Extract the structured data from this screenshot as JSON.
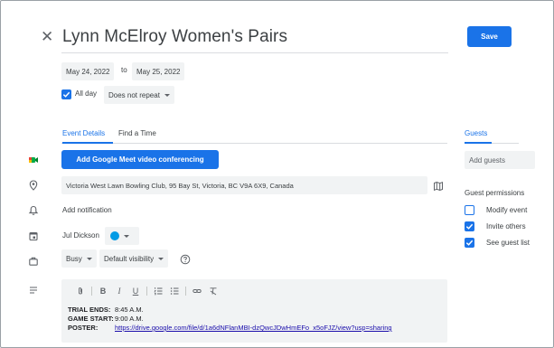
{
  "event": {
    "title": "Lynn McElroy Women's Pairs",
    "save_label": "Save",
    "start_date": "May 24, 2022",
    "to_label": "to",
    "end_date": "May 25, 2022",
    "all_day_label": "All day",
    "all_day_checked": true,
    "repeat_label": "Does not repeat"
  },
  "tabs": [
    {
      "label": "Event Details",
      "active": true
    },
    {
      "label": "Find a Time",
      "active": false
    }
  ],
  "details": {
    "meet_button_label": "Add Google Meet video conferencing",
    "location": "Victoria West Lawn Bowling Club, 95 Bay St, Victoria, BC V9A 6X9, Canada",
    "add_notification_label": "Add notification",
    "calendar_owner": "Jul Dickson",
    "calendar_color": "#039be5",
    "busy_label": "Busy",
    "visibility_label": "Default visibility"
  },
  "toolbar_icons": [
    "attach-icon",
    "bold-icon",
    "italic-icon",
    "underline-icon",
    "numbered-list-icon",
    "bulleted-list-icon",
    "link-icon",
    "clear-format-icon"
  ],
  "description": {
    "lines": [
      {
        "key": "TRIAL ENDS:",
        "value": "8:45 A.M."
      },
      {
        "key": "GAME START:",
        "value": "9:00 A.M."
      },
      {
        "key": "POSTER:",
        "value": "https://drive.google.com/file/d/1a6dNFlanMBI-dzQwcJDwHmEFo_x5oFJZ/view?usp=sharing"
      }
    ]
  },
  "guests": {
    "title": "Guests",
    "add_placeholder": "Add guests",
    "permissions_title": "Guest permissions",
    "permissions": [
      {
        "label": "Modify event",
        "checked": false
      },
      {
        "label": "Invite others",
        "checked": true
      },
      {
        "label": "See guest list",
        "checked": true
      }
    ]
  },
  "colors": {
    "accent": "#1a73e8",
    "chip_bg": "#f1f3f4",
    "meet_icon_green": "#00ac47"
  }
}
